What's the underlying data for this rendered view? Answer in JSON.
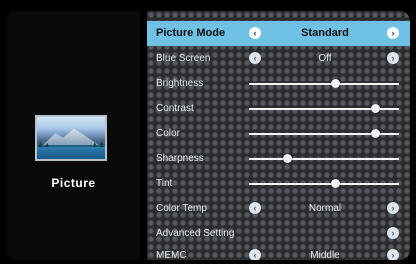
{
  "left": {
    "label": "Picture",
    "image": "landscape-thumbnail"
  },
  "menu": [
    {
      "label": "Picture Mode",
      "type": "select",
      "value": "Standard",
      "selected": true
    },
    {
      "label": "Blue Screen",
      "type": "select",
      "value": "Off"
    },
    {
      "label": "Brightness",
      "type": "slider",
      "level": 0.57
    },
    {
      "label": "Contrast",
      "type": "slider",
      "level": 0.84
    },
    {
      "label": "Color",
      "type": "slider",
      "level": 0.84
    },
    {
      "label": "Sharpness",
      "type": "slider",
      "level": 0.25
    },
    {
      "label": "Tint",
      "type": "slider",
      "level": 0.57
    },
    {
      "label": "Color Temp",
      "type": "select",
      "value": "Normal"
    },
    {
      "label": "Advanced Setting",
      "type": "submenu"
    },
    {
      "label": "MEMC",
      "type": "select",
      "value": "Middle"
    }
  ],
  "icons": {
    "left_arrow": "‹",
    "right_arrow": "›"
  },
  "colors": {
    "highlight": "#6fc2e4",
    "panel": "#2b2d31"
  }
}
